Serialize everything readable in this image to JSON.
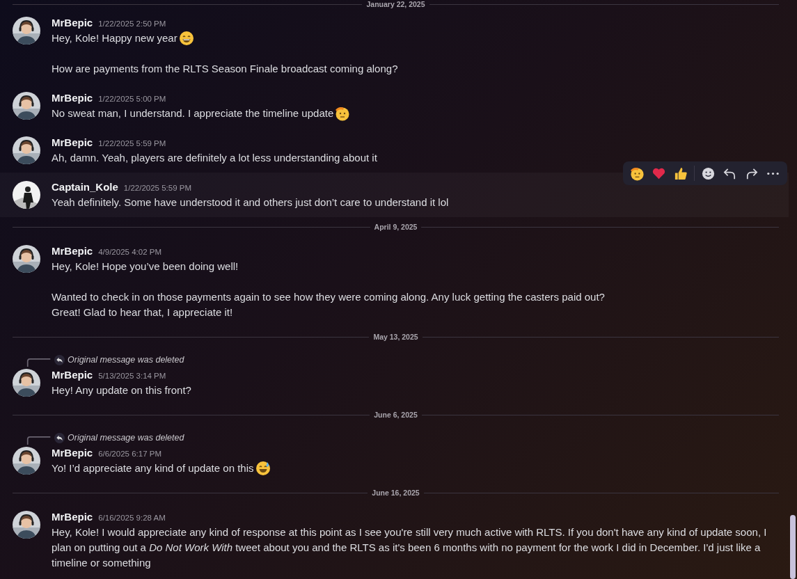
{
  "items": [
    {
      "kind": "divider",
      "label": "January 22, 2025"
    },
    {
      "kind": "message",
      "author": "MrBepic",
      "avatar": {
        "kind": "headset"
      },
      "timestamp": "1/22/2025 2:50 PM",
      "hovered": false,
      "blocks": [
        {
          "lines": [
            {
              "text": "Hey, Kole! Happy new year",
              "emoji": {
                "kind": "grin"
              }
            }
          ]
        },
        {
          "lines": [
            {
              "text": "How are payments from the RLTS Season Finale broadcast coming along?"
            }
          ]
        }
      ]
    },
    {
      "kind": "message",
      "author": "MrBepic",
      "avatar": {
        "kind": "headset"
      },
      "timestamp": "1/22/2025 5:00 PM",
      "hovered": false,
      "blocks": [
        {
          "lines": [
            {
              "text": "No sweat man, I understand. I appreciate the timeline update",
              "emoji": {
                "kind": "salute"
              }
            }
          ]
        }
      ]
    },
    {
      "kind": "message",
      "author": "MrBepic",
      "avatar": {
        "kind": "headset"
      },
      "timestamp": "1/22/2025 5:59 PM",
      "hovered": false,
      "blocks": [
        {
          "lines": [
            {
              "text": "Ah, damn. Yeah, players are definitely a lot less understanding about it"
            }
          ]
        }
      ]
    },
    {
      "kind": "message",
      "author": "Captain_Kole",
      "avatar": {
        "kind": "mono"
      },
      "timestamp": "1/22/2025 5:59 PM",
      "hovered": true,
      "blocks": [
        {
          "lines": [
            {
              "text": "Yeah definitely. Some have understood it and others just don’t care to understand it lol"
            }
          ]
        }
      ]
    },
    {
      "kind": "divider",
      "label": "April 9, 2025"
    },
    {
      "kind": "message",
      "author": "MrBepic",
      "avatar": {
        "kind": "headset"
      },
      "timestamp": "4/9/2025 4:02 PM",
      "hovered": false,
      "blocks": [
        {
          "lines": [
            {
              "text": "Hey, Kole! Hope you’ve been doing well!"
            }
          ]
        },
        {
          "lines": [
            {
              "text": "Wanted to check in on those payments again to see how they were coming along. Any luck getting the casters paid out?"
            },
            {
              "text": "Great! Glad to hear that, I appreciate it!"
            }
          ]
        }
      ]
    },
    {
      "kind": "divider",
      "label": "May 13, 2025"
    },
    {
      "kind": "message",
      "author": "MrBepic",
      "avatar": {
        "kind": "headset"
      },
      "timestamp": "5/13/2025 3:14 PM",
      "hovered": false,
      "reply": "Original message was deleted",
      "blocks": [
        {
          "lines": [
            {
              "text": "Hey! Any update on this front?"
            }
          ]
        }
      ]
    },
    {
      "kind": "divider",
      "label": "June 6, 2025"
    },
    {
      "kind": "message",
      "author": "MrBepic",
      "avatar": {
        "kind": "headset"
      },
      "timestamp": "6/6/2025 6:17 PM",
      "hovered": false,
      "reply": "Original message was deleted",
      "blocks": [
        {
          "lines": [
            {
              "text": "Yo! I’d appreciate any kind of update on this",
              "emoji": {
                "kind": "sweat"
              }
            }
          ]
        }
      ]
    },
    {
      "kind": "divider",
      "label": "June 16, 2025"
    },
    {
      "kind": "message",
      "author": "MrBepic",
      "avatar": {
        "kind": "headset"
      },
      "timestamp": "6/16/2025 9:28 AM",
      "hovered": false,
      "blocks": [
        {
          "lines": [
            {
              "text": "Hey, Kole! I would appreciate any kind of response at this point as I see you're still very much active with RLTS. If you don't have any kind of update soon, I plan on putting out a *Do Not Work With* tweet about you and the RLTS as it's been 6 months with no payment for the work I did in December. I'd just like a timeline or something"
            }
          ]
        }
      ]
    }
  ]
}
